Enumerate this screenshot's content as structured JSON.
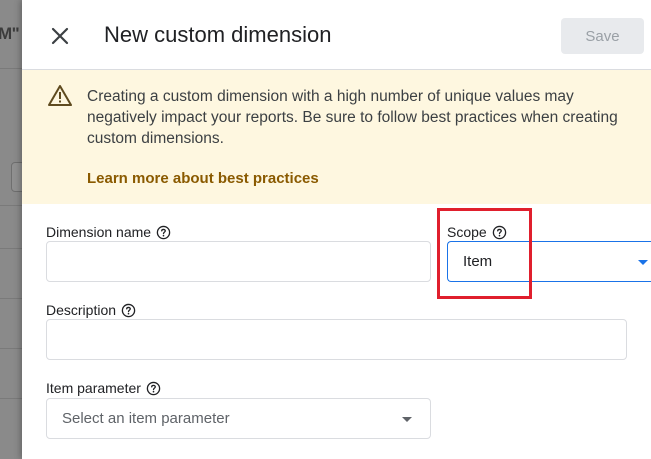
{
  "background": {
    "partial_text": "M\""
  },
  "header": {
    "title": "New custom dimension",
    "save_label": "Save"
  },
  "warning": {
    "message": "Creating a custom dimension with a high number of unique values may negatively impact your reports. Be sure to follow best practices when creating custom dimensions.",
    "link_text": "Learn more about best practices"
  },
  "form": {
    "dimension_name": {
      "label": "Dimension name",
      "value": "",
      "placeholder": ""
    },
    "scope": {
      "label": "Scope",
      "selected": "Item"
    },
    "description": {
      "label": "Description",
      "value": "",
      "placeholder": ""
    },
    "item_parameter": {
      "label": "Item parameter",
      "placeholder": "Select an item parameter"
    }
  },
  "colors": {
    "accent": "#1a73e8",
    "warning_bg": "#fef7e0",
    "link": "#8a5a00",
    "highlight": "#e01f2d"
  },
  "icons": {
    "close": "close-icon",
    "warning": "warning-triangle-icon",
    "help": "help-circle-icon",
    "dropdown": "caret-down-icon"
  }
}
